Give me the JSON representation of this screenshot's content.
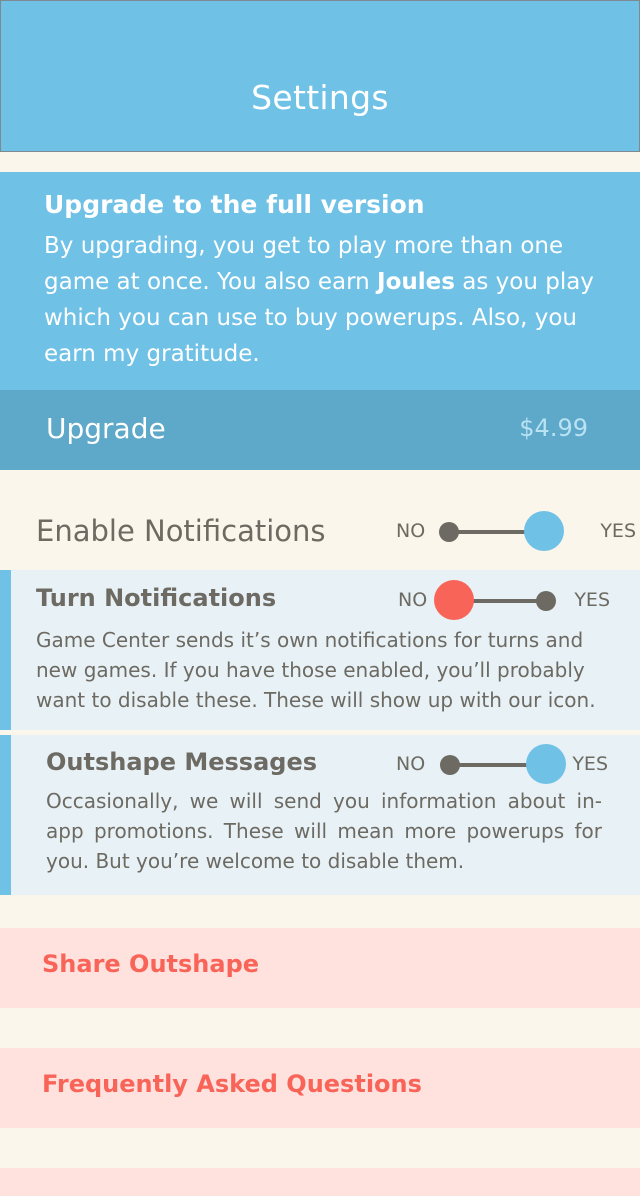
{
  "header": {
    "title": "Settings"
  },
  "upgrade": {
    "title": "Upgrade to the full version",
    "desc_before": "By upgrading, you get to play more than one game at once. You also earn ",
    "desc_bold": "Joules",
    "desc_after": " as you play which you can use to buy powerups. Also, you earn my gratitude.",
    "button_label": "Upgrade",
    "price": "$4.99"
  },
  "enable_notifications": {
    "label": "Enable Notifications",
    "no": "NO",
    "yes": "YES",
    "value": "YES"
  },
  "turn_notifications": {
    "title": "Turn Notifications",
    "description": "Game Center sends it’s own notifications for turns and new games. If you have those enabled, you’ll probably want to disable these. These will show up with our icon.",
    "no": "NO",
    "yes": "YES",
    "value": "NO"
  },
  "outshape_messages": {
    "title": "Outshape Messages",
    "description": "Occasionally, we will send you information about in-app promotions. These will mean more powerups for you. But you’re welcome to disable them.",
    "no": "NO",
    "yes": "YES",
    "value": "YES"
  },
  "links": {
    "share": "Share Outshape",
    "faq": "Frequently Asked Questions"
  },
  "colors": {
    "header_blue": "#70c1e6",
    "upgrade_bar": "#5ea8c9",
    "accent_red": "#f96459",
    "text_gray": "#6c6a62",
    "background": "#fbf6ec",
    "sub_background": "#e8f1f5",
    "link_background": "#ffe1dd"
  }
}
